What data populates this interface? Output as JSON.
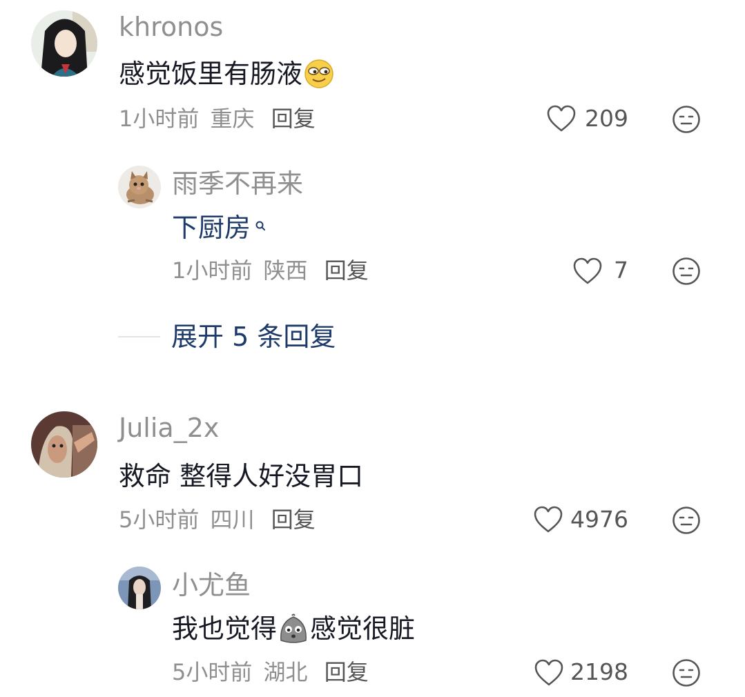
{
  "comments": [
    {
      "username": "khronos",
      "text": "感觉饭里有肠液",
      "emoji": "smug-face-emoji",
      "time": "1小时前",
      "location": "重庆",
      "reply_label": "回复",
      "likes": "209"
    },
    {
      "username": "雨季不再来",
      "text": "下厨房",
      "link_icon": "search-icon",
      "time": "1小时前",
      "location": "陕西",
      "reply_label": "回复",
      "likes": "7"
    },
    {
      "username": "Julia_2x",
      "text": "救命 整得人好没胃口",
      "time": "5小时前",
      "location": "四川",
      "reply_label": "回复",
      "likes": "4976"
    },
    {
      "username": "小尤鱼",
      "text_before": "我也觉得",
      "emoji": "dumpling-face-emoji",
      "text_after": "感觉很脏",
      "time": "5小时前",
      "location": "湖北",
      "reply_label": "回复",
      "likes": "2198"
    }
  ],
  "expand": {
    "label": "展开 5 条回复"
  },
  "colors": {
    "username": "#8f8f8f",
    "link": "#1d3a6b",
    "text": "#161823"
  }
}
